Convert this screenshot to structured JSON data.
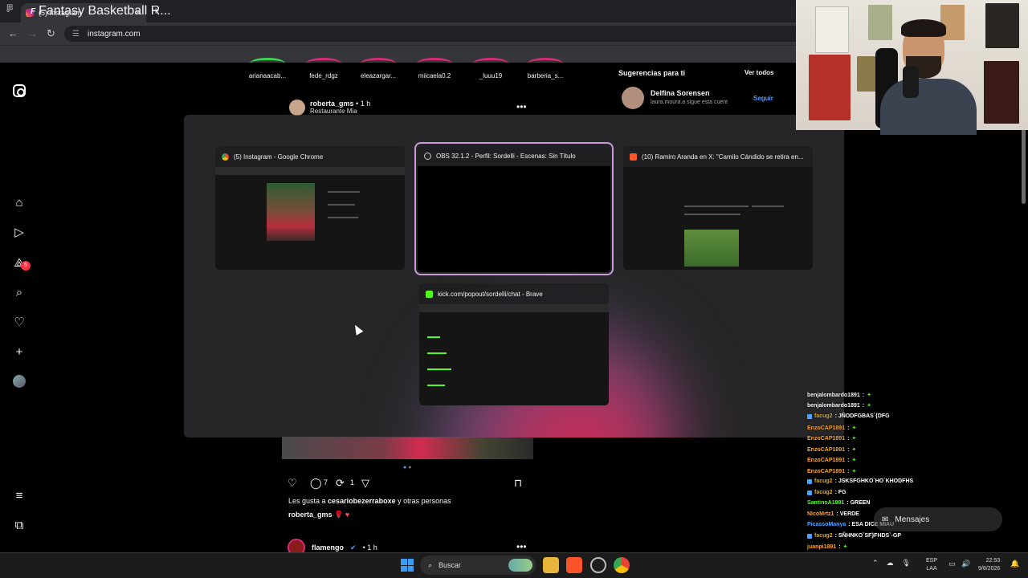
{
  "browser": {
    "tab_title": "(5) Instagram",
    "url": "instagram.com",
    "bookmark": "Fantasy Basketball R..."
  },
  "instagram": {
    "stories": [
      "arianaacab...",
      "fede_rdgz",
      "eleazargar...",
      "miicaela0.2",
      "_luuu19",
      "barberia_s..."
    ],
    "post1": {
      "user": "roberta_gms",
      "time": "• 1 h",
      "location": "Restaurante Mia"
    },
    "suggestions": {
      "title": "Sugerencias para ti",
      "see_all": "Ver todos",
      "name": "Delfina Sorensen",
      "sub": "laura.moura.a sigue esta cuent",
      "follow": "Seguir"
    },
    "actions": {
      "comments": "7",
      "reposts": "1"
    },
    "likes_prefix": "Les gusta a ",
    "likes_user": "cesariobezerraboxe",
    "likes_suffix": " y otras personas",
    "caption_user": "roberta_gms",
    "caption_hearts": "🌹 ♥",
    "post2": {
      "user": "flamengo",
      "time": "• 1 h"
    },
    "notifications_badge": "5"
  },
  "switcher": {
    "windows": [
      {
        "title": "(5) Instagram - Google Chrome"
      },
      {
        "title": "OBS 32.1.2 - Perfil: Sordelli - Escenas: Sin Título"
      },
      {
        "title": "(10) Ramiro Aranda en X: \"Camilo Cándido se retira en..."
      },
      {
        "title": "kick.com/popout/sordelli/chat - Brave"
      }
    ]
  },
  "chat": {
    "messages": [
      {
        "user": "benjalombardo1891",
        "text": ": ",
        "color": "#e8e8e8"
      },
      {
        "user": "benjalombardo1891",
        "text": ": ",
        "color": "#e8e8e8"
      },
      {
        "user": "facug2",
        "text": ": JÑODFGBAS`{DFG",
        "color": "#e0a800"
      },
      {
        "user": "EnzoCAP1891",
        "text": ": ",
        "color": "#f5a623"
      },
      {
        "user": "EnzoCAP1891",
        "text": ": ",
        "color": "#f5a623"
      },
      {
        "user": "EnzoCAP1891",
        "text": ": ",
        "color": "#f5a623"
      },
      {
        "user": "EnzoCAP1891",
        "text": ": ",
        "color": "#f5a623"
      },
      {
        "user": "EnzoCAP1891",
        "text": ": ",
        "color": "#f5a623"
      },
      {
        "user": "facug2",
        "text": ": JSKSFGHKO`HO`KHODFHS",
        "color": "#e0a800"
      },
      {
        "user": "facug2",
        "text": ": FG",
        "color": "#e0a800"
      },
      {
        "user": "SantinoA1891",
        "text": ": GREEN",
        "color": "#53fc18"
      },
      {
        "user": "NIcoMrtz1",
        "text": ": VERDE",
        "color": "#ff9f43"
      },
      {
        "user": "PicassoManya",
        "text": ": ESA DICE MIAU",
        "color": "#4aa3ff"
      },
      {
        "user": "facug2",
        "text": ": SÑHNKO`SF}FHDS`-GP",
        "color": "#e0a800"
      },
      {
        "user": "juanpi1891",
        "text": ": ",
        "color": "#f5a623"
      }
    ],
    "mensajes": "Mensajes"
  },
  "taskbar": {
    "search": "Buscar",
    "lang1": "ESP",
    "lang2": "LAA",
    "time": "22:53",
    "date": "9/8/2026"
  }
}
